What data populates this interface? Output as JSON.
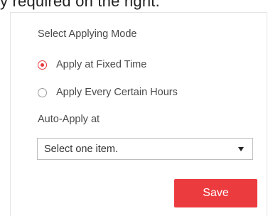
{
  "page_header": {
    "partial_text": "y required on the right."
  },
  "applying_mode": {
    "title": "Select Applying Mode",
    "options": [
      {
        "label": "Apply at Fixed Time",
        "selected": true
      },
      {
        "label": "Apply Every Certain Hours",
        "selected": false
      }
    ]
  },
  "auto_apply": {
    "label": "Auto-Apply at",
    "select_value": "Select one item."
  },
  "actions": {
    "save_label": "Save"
  },
  "colors": {
    "accent": "#ec3b3f",
    "border": "#bdbdbd",
    "text": "#4a4a4a"
  },
  "icons": {
    "dropdown": "caret-down-icon",
    "radio_checked": "radio-checked-icon",
    "radio_unchecked": "radio-unchecked-icon"
  }
}
